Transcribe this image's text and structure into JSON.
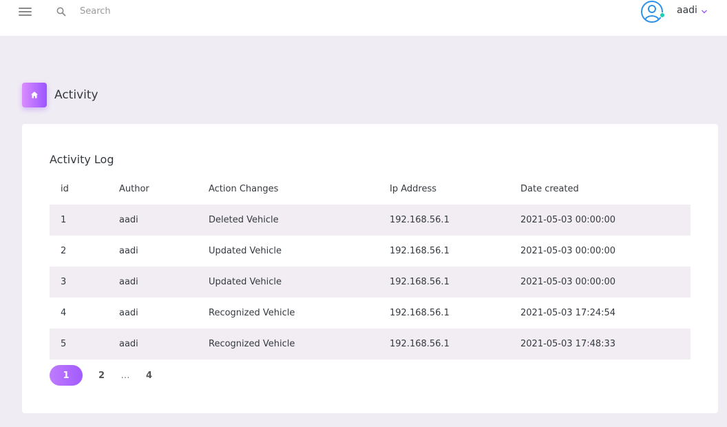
{
  "topbar": {
    "search_placeholder": "Search",
    "user_name": "aadi",
    "icons": [
      "menu-icon",
      "search-icon",
      "user-circle-icon",
      "chevron-down-icon"
    ]
  },
  "page_header": {
    "title": "Activity",
    "icon": "home-icon"
  },
  "activity_log": {
    "title": "Activity Log",
    "columns": [
      "id",
      "Author",
      "Action Changes",
      "Ip Address",
      "Date created"
    ],
    "rows": [
      [
        "1",
        "aadi",
        "Deleted Vehicle",
        "192.168.56.1",
        "2021-05-03 00:00:00"
      ],
      [
        "2",
        "aadi",
        "Updated Vehicle",
        "192.168.56.1",
        "2021-05-03 00:00:00"
      ],
      [
        "3",
        "aadi",
        "Updated Vehicle",
        "192.168.56.1",
        "2021-05-03 00:00:00"
      ],
      [
        "4",
        "aadi",
        "Recognized Vehicle",
        "192.168.56.1",
        "2021-05-03 17:24:54"
      ],
      [
        "5",
        "aadi",
        "Recognized Vehicle",
        "192.168.56.1",
        "2021-05-03 17:48:33"
      ]
    ]
  },
  "pagination": {
    "pages": [
      "1",
      "2",
      "…",
      "4"
    ],
    "active": "1"
  },
  "colors": {
    "accent": "#9a55ff",
    "accent_light": "#da8cff",
    "background": "#f0ecf3",
    "status_online": "#1bcfb4",
    "avatar_blue": "#2e93e6"
  }
}
